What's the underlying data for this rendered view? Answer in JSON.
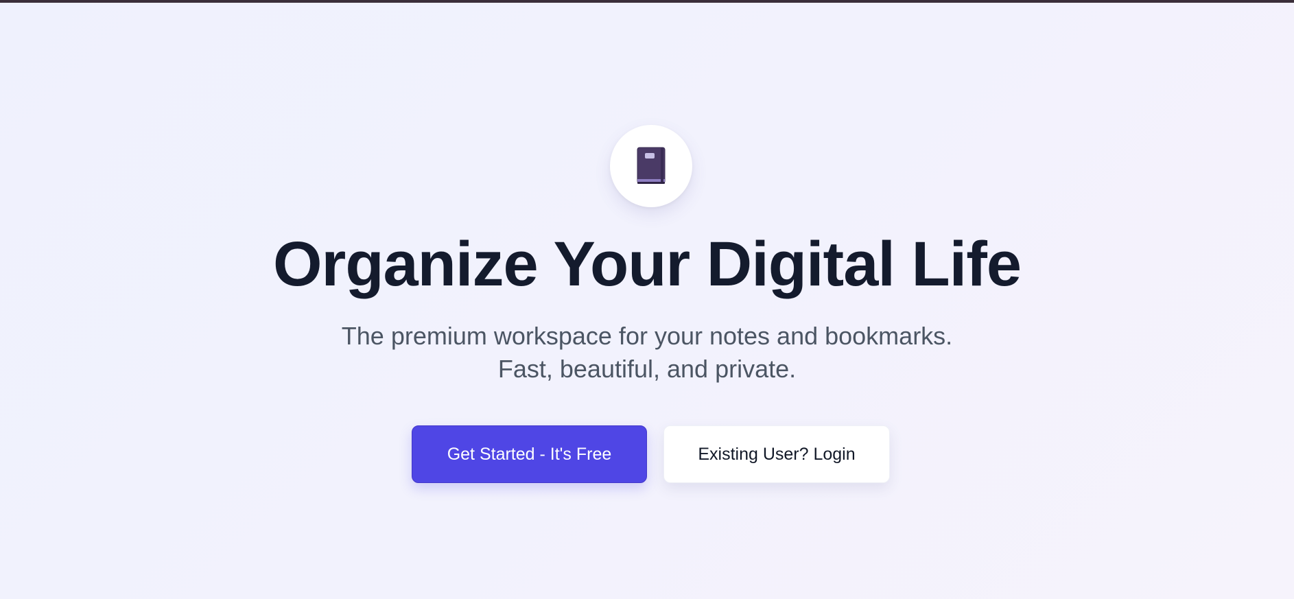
{
  "hero": {
    "logo_icon": "notebook-icon",
    "headline": "Organize Your Digital Life",
    "subtitle_line1": "The premium workspace for your notes and bookmarks.",
    "subtitle_line2": "Fast, beautiful, and private."
  },
  "actions": {
    "primary_label": "Get Started - It's Free",
    "secondary_label": "Existing User? Login"
  },
  "colors": {
    "accent": "#4f46e5",
    "headline": "#141b2d",
    "subtitle": "#4b5563",
    "notebook": "#4a3a66"
  }
}
